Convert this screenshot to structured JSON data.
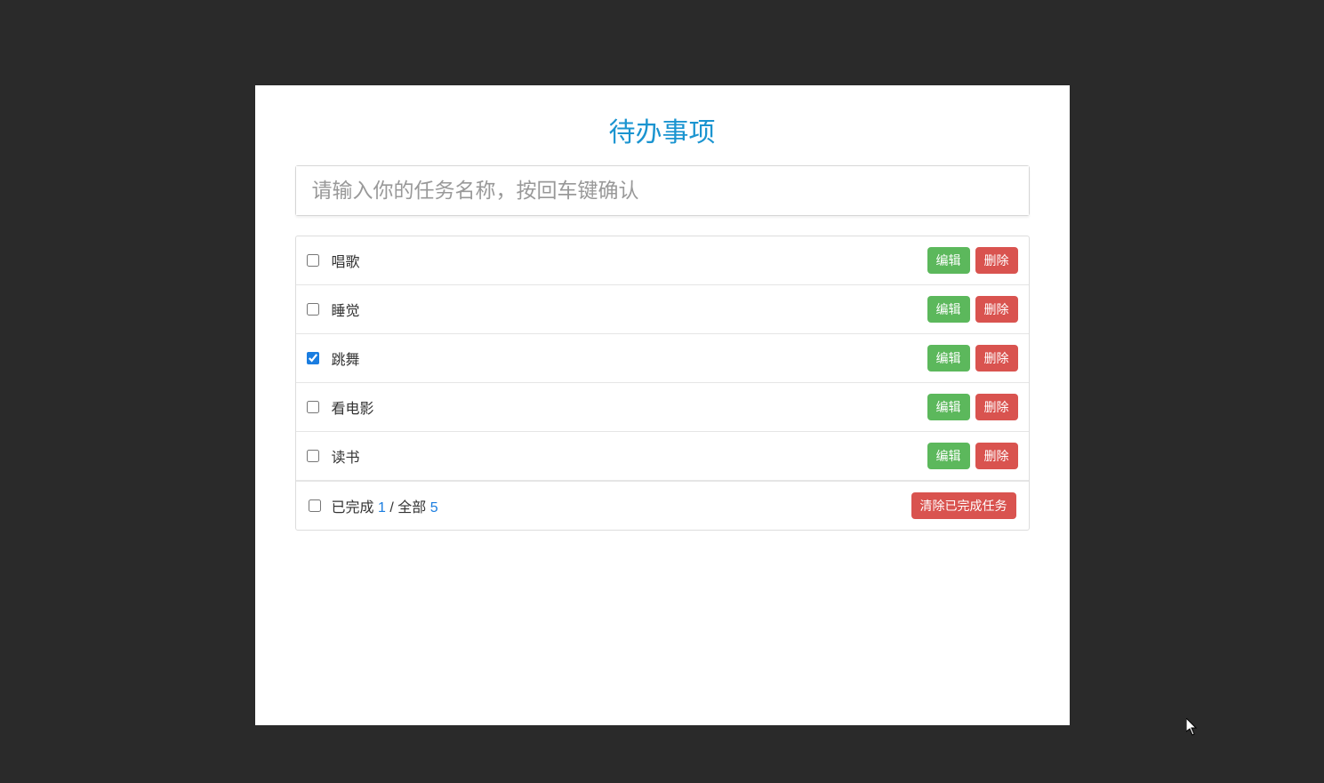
{
  "title": "待办事项",
  "input": {
    "placeholder": "请输入你的任务名称，按回车键确认",
    "value": ""
  },
  "tasks": [
    {
      "label": "唱歌",
      "done": false
    },
    {
      "label": "睡觉",
      "done": false
    },
    {
      "label": "跳舞",
      "done": true
    },
    {
      "label": "看电影",
      "done": false
    },
    {
      "label": "读书",
      "done": false
    }
  ],
  "buttons": {
    "edit": "编辑",
    "delete": "删除",
    "clear": "清除已完成任务"
  },
  "footer": {
    "select_all": false,
    "done_prefix": "已完成",
    "done_count": "1",
    "sep": " / ",
    "total_prefix": "全部",
    "total_count": "5"
  }
}
